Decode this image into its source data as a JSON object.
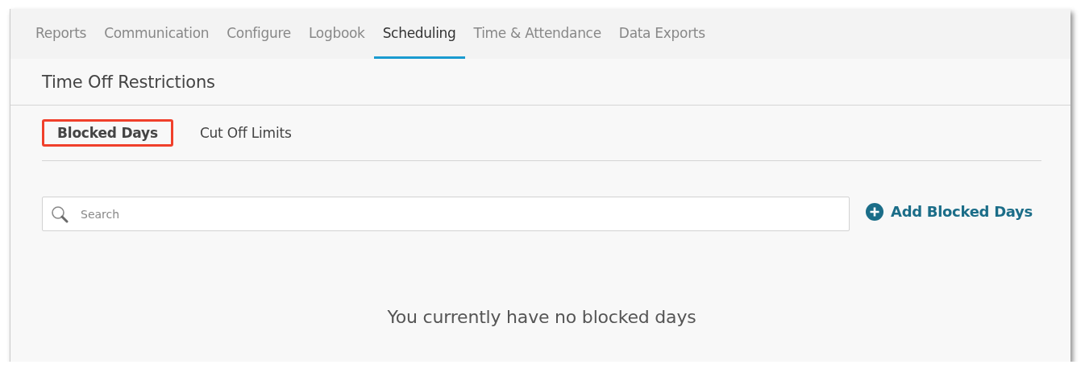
{
  "nav_tabs": [
    {
      "label": "Reports",
      "selected": false
    },
    {
      "label": "Communication",
      "selected": false
    },
    {
      "label": "Configure",
      "selected": false
    },
    {
      "label": "Logbook",
      "selected": false
    },
    {
      "label": "Scheduling",
      "selected": true
    },
    {
      "label": "Time & Attendance",
      "selected": false
    },
    {
      "label": "Data Exports",
      "selected": false
    }
  ],
  "page_title": "Time Off Restrictions",
  "sub_tabs": [
    {
      "label": "Blocked Days",
      "selected": true,
      "highlighted": true
    },
    {
      "label": "Cut Off Limits",
      "selected": false,
      "highlighted": false
    }
  ],
  "search": {
    "placeholder": "Search"
  },
  "add_button": "Add Blocked Days",
  "empty_message": "You currently have no blocked days"
}
